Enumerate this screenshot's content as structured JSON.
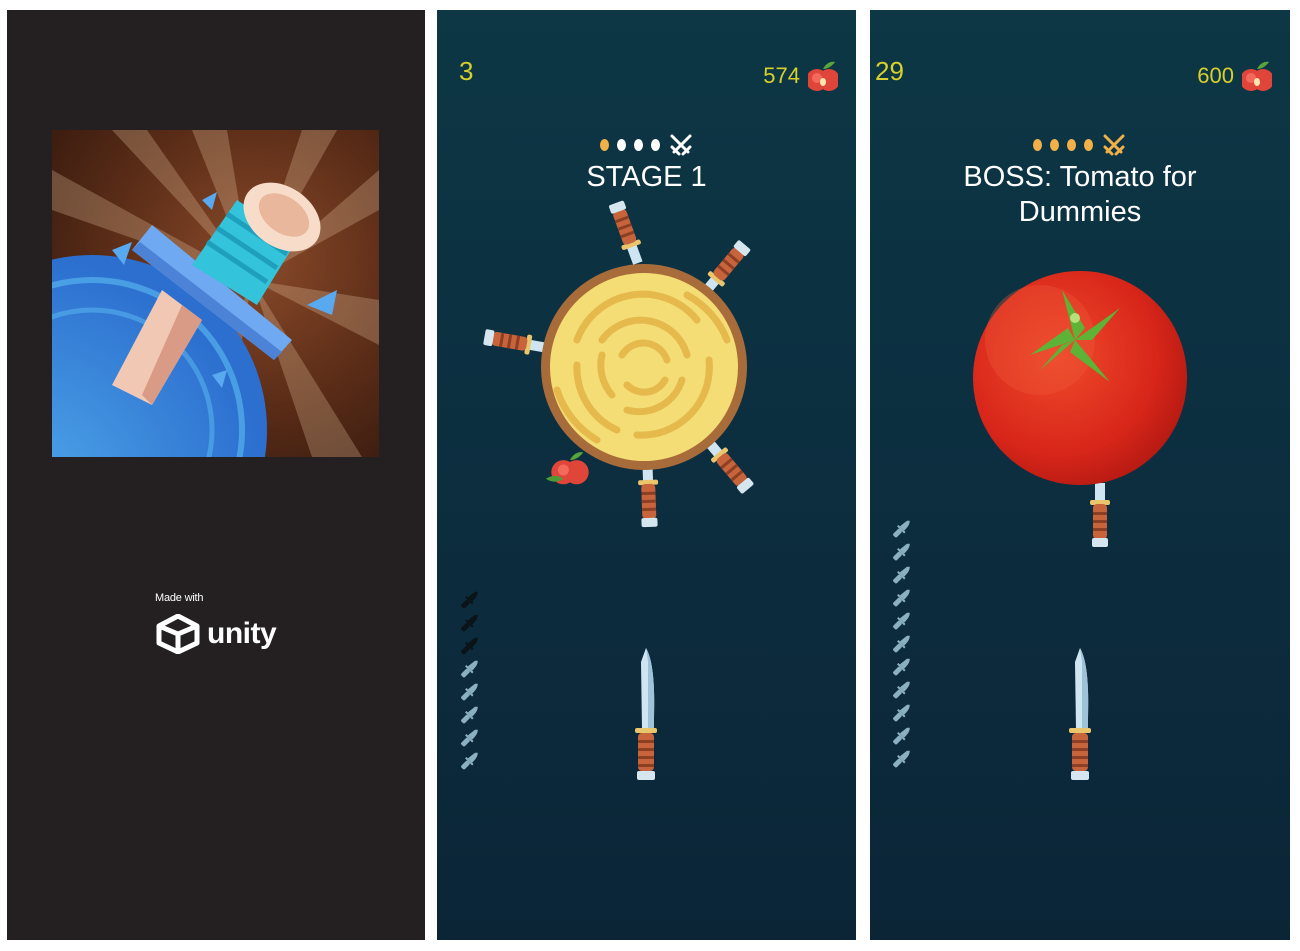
{
  "splash": {
    "made_with": "Made with",
    "engine": "unity"
  },
  "stage": {
    "score": "3",
    "apples": "574",
    "title": "STAGE 1",
    "progress": [
      "done",
      "todo",
      "todo",
      "todo"
    ],
    "boss_icon_color": "#ffffff",
    "knives_total": 8,
    "knives_used": 3
  },
  "boss": {
    "score": "29",
    "apples": "600",
    "title_line1": "BOSS: Tomato for",
    "title_line2": "Dummies",
    "progress": [
      "done",
      "done",
      "done",
      "done"
    ],
    "boss_icon_color": "#f2b049",
    "knives_total": 11,
    "knives_used": 0
  },
  "colors": {
    "score_yellow": "#d7cf2c",
    "dot_done": "#f2b049",
    "mini_knife_remaining": "#8bb0c2",
    "mini_knife_used": "#0a1418"
  }
}
